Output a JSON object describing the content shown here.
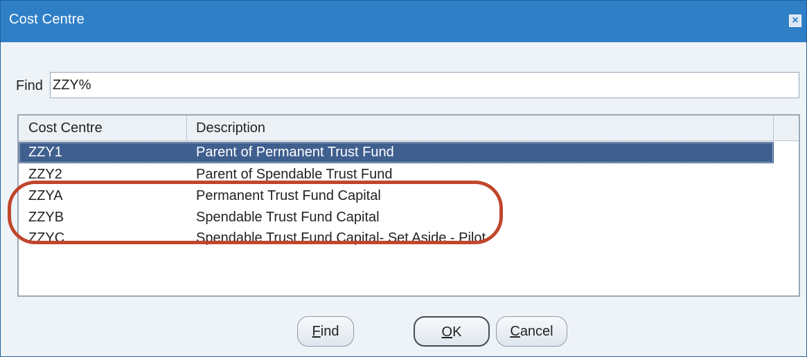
{
  "window": {
    "title": "Cost Centre",
    "close_symbol": "×"
  },
  "find": {
    "label": "Find",
    "value": "ZZY%"
  },
  "list": {
    "columns": [
      "Cost Centre",
      "Description"
    ],
    "rows": [
      {
        "code": "ZZY1",
        "description": "Parent of Permanent Trust Fund",
        "selected": true
      },
      {
        "code": "ZZY2",
        "description": "Parent of Spendable Trust Fund",
        "selected": false
      },
      {
        "code": "ZZYA",
        "description": "Permanent Trust Fund Capital",
        "selected": false
      },
      {
        "code": "ZZYB",
        "description": "Spendable Trust Fund Capital",
        "selected": false
      },
      {
        "code": "ZZYC",
        "description": "Spendable Trust Fund Capital- Set Aside - Pilot",
        "selected": false
      }
    ]
  },
  "buttons": {
    "find": {
      "mnemonic": "F",
      "rest": "ind"
    },
    "ok": {
      "mnemonic": "O",
      "rest": "K"
    },
    "cancel": {
      "mnemonic": "C",
      "rest": "ancel"
    }
  },
  "colors": {
    "titlebar": "#2f7fc7",
    "selection": "#3f5f8f",
    "annotation": "#c0462c"
  }
}
